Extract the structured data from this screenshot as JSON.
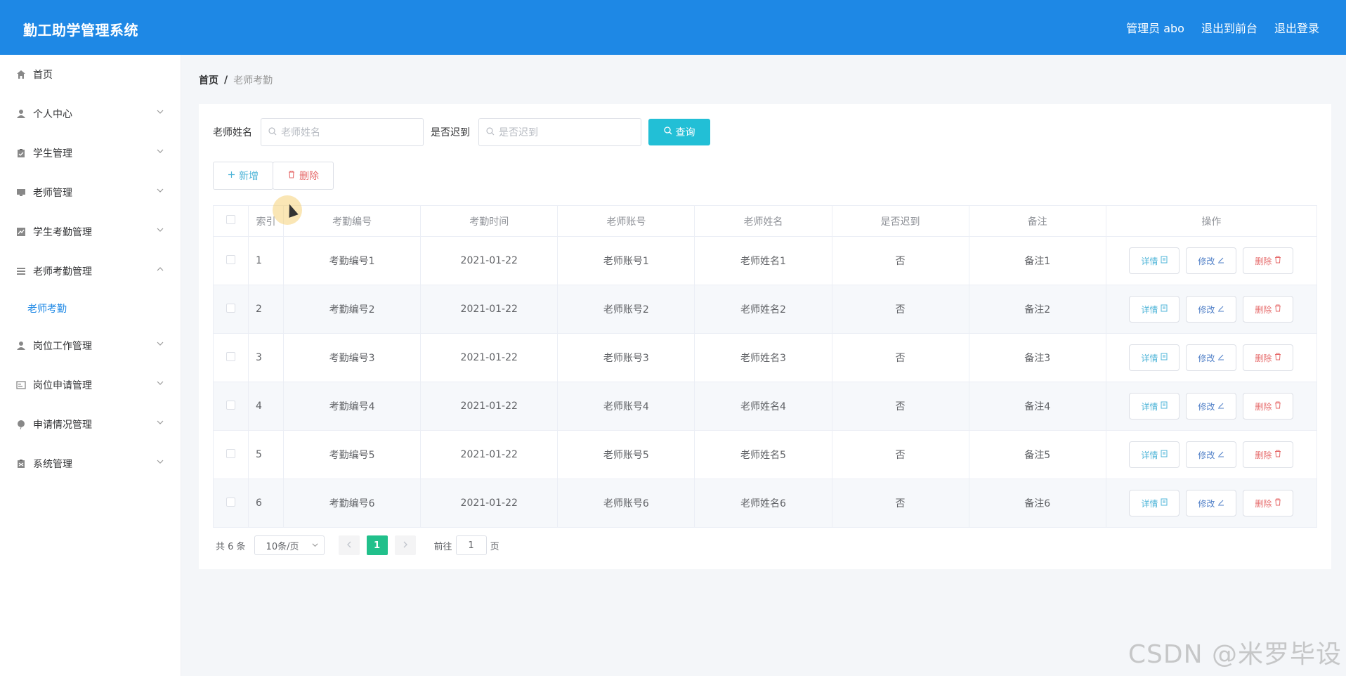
{
  "header": {
    "app_title": "勤工助学管理系统",
    "user_label": "管理员 abo",
    "front_label": "退出到前台",
    "logout_label": "退出登录"
  },
  "sidebar": {
    "items": [
      {
        "label": "首页",
        "icon": "home-icon"
      },
      {
        "label": "个人中心",
        "icon": "user-icon"
      },
      {
        "label": "学生管理",
        "icon": "clipboard-icon"
      },
      {
        "label": "老师管理",
        "icon": "monitor-icon"
      },
      {
        "label": "学生考勤管理",
        "icon": "chart-icon"
      },
      {
        "label": "老师考勤管理",
        "icon": "list-icon"
      },
      {
        "label": "岗位工作管理",
        "icon": "user-icon"
      },
      {
        "label": "岗位申请管理",
        "icon": "card-icon"
      },
      {
        "label": "申请情况管理",
        "icon": "balloon-icon"
      },
      {
        "label": "系统管理",
        "icon": "clipboard-icon"
      }
    ],
    "active_sub": "老师考勤"
  },
  "breadcrumb": {
    "home": "首页",
    "separator": "/",
    "current": "老师考勤"
  },
  "search": {
    "name_label": "老师姓名",
    "name_placeholder": "老师姓名",
    "late_label": "是否迟到",
    "late_placeholder": "是否迟到",
    "query_label": "查询"
  },
  "actions": {
    "add_label": "新增",
    "delete_label": "删除"
  },
  "table": {
    "headers": [
      "索引",
      "考勤编号",
      "考勤时间",
      "老师账号",
      "老师姓名",
      "是否迟到",
      "备注",
      "操作"
    ],
    "rows": [
      {
        "idx": "1",
        "code": "考勤编号1",
        "time": "2021-01-22",
        "account": "老师账号1",
        "name": "老师姓名1",
        "late": "否",
        "note": "备注1"
      },
      {
        "idx": "2",
        "code": "考勤编号2",
        "time": "2021-01-22",
        "account": "老师账号2",
        "name": "老师姓名2",
        "late": "否",
        "note": "备注2"
      },
      {
        "idx": "3",
        "code": "考勤编号3",
        "time": "2021-01-22",
        "account": "老师账号3",
        "name": "老师姓名3",
        "late": "否",
        "note": "备注3"
      },
      {
        "idx": "4",
        "code": "考勤编号4",
        "time": "2021-01-22",
        "account": "老师账号4",
        "name": "老师姓名4",
        "late": "否",
        "note": "备注4"
      },
      {
        "idx": "5",
        "code": "考勤编号5",
        "time": "2021-01-22",
        "account": "老师账号5",
        "name": "老师姓名5",
        "late": "否",
        "note": "备注5"
      },
      {
        "idx": "6",
        "code": "考勤编号6",
        "time": "2021-01-22",
        "account": "老师账号6",
        "name": "老师姓名6",
        "late": "否",
        "note": "备注6"
      }
    ],
    "op_detail": "详情",
    "op_edit": "修改",
    "op_delete": "删除"
  },
  "pager": {
    "total": "共 6 条",
    "page_size": "10条/页",
    "current_page": "1",
    "goto_label": "前往",
    "goto_value": "1",
    "page_unit": "页"
  },
  "watermark": "CSDN @米罗毕设",
  "colors": {
    "header_bg": "#1e88e5",
    "query_btn": "#22bfd6",
    "active_page": "#21c08b",
    "danger": "#e66b6b"
  }
}
